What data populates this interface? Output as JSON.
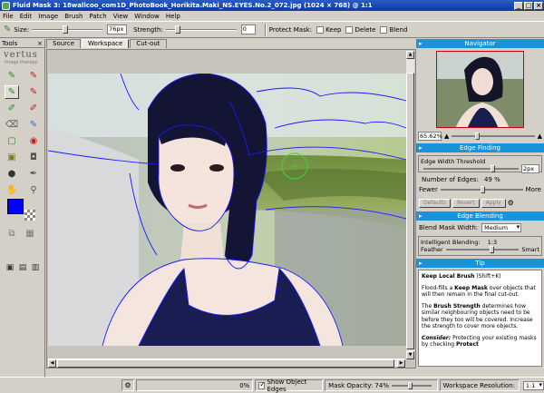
{
  "window": {
    "title": "Fluid Mask 3: 18wallcoo_com1D_PhotoBook_Horikita.Maki_NS.EYES.No.2_072.jpg (1024 × 768) @ 1:1",
    "minimize": "_",
    "maximize": "□",
    "close": "×"
  },
  "menu": [
    "File",
    "Edit",
    "Image",
    "Brush",
    "Patch",
    "View",
    "Window",
    "Help"
  ],
  "toolbar": {
    "size_label": "Size:",
    "size_value": "76px",
    "strength_label": "Strength:",
    "strength_value": "0",
    "protect_mask_label": "Protect Mask:",
    "keep_label": "Keep",
    "delete_label": "Delete",
    "blend_label": "Blend"
  },
  "tools": {
    "header": "Tools",
    "close": "×",
    "brand": "vertus",
    "brand_sub": "image therapy",
    "foreground_color": "#0000ff"
  },
  "tabs": [
    "Source",
    "Workspace",
    "Cut-out"
  ],
  "navigator": {
    "title": "Navigator",
    "zoom": "65.62%"
  },
  "edge_finding": {
    "title": "Edge Finding",
    "threshold_label": "Edge Width Threshold",
    "threshold_value": "2px",
    "num_edges_label": "Number of Edges:",
    "num_edges_value": "49 %",
    "fewer": "Fewer",
    "more": "More",
    "defaults_btn": "Defaults",
    "revert_btn": "Revert",
    "apply_btn": "Apply"
  },
  "edge_blending": {
    "title": "Edge Blending",
    "blend_mask_label": "Blend Mask Width:",
    "blend_mask_value": "Medium",
    "intelligent_label": "Intelligent Blending:",
    "intelligent_value": "1:3",
    "feather": "Feather",
    "smart": "Smart"
  },
  "tip": {
    "title": "Tip",
    "heading": "Keep Local Brush",
    "shortcut": "(Shift+K)",
    "p1a": "Flood-fills a ",
    "p1b": "Keep Mask",
    "p1c": " over objects that will then remain in the final cut-out.",
    "p2a": "The ",
    "p2b": "Brush Strength",
    "p2c": " determines how similar neighbouring objects need to be before they too will be covered. Increase the strength to cover more objects.",
    "p3a": "Consider:",
    "p3b": " Protecting your existing masks by checking ",
    "p3c": "Protect"
  },
  "status": {
    "progress": "0%",
    "show_edges_label": "Show Object Edges",
    "mask_opacity": "Mask Opacity: 74%",
    "resolution_label": "Workspace Resolution:",
    "resolution_value": "1:1"
  }
}
